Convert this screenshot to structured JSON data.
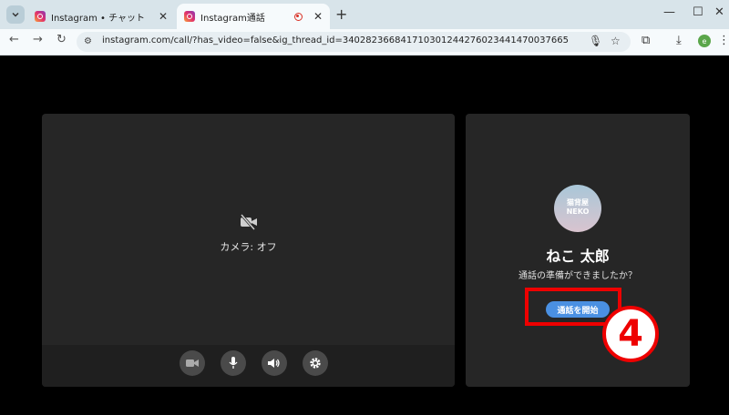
{
  "browser": {
    "tabs": [
      {
        "title": "Instagram • チャット"
      },
      {
        "title": "Instagram通話"
      }
    ],
    "url": "instagram.com/call/?has_video=false&ig_thread_id=340282366841710301244276023441470037665",
    "profile_initial": "e"
  },
  "call": {
    "camera_status": "カメラ: オフ",
    "avatar_text": [
      "猫背屋",
      "NEKO"
    ],
    "callee_name": "ねこ 太郎",
    "prompt": "通話の準備ができましたか？",
    "start_label": "通話を開始",
    "accent_color": "#4a90e2"
  },
  "annotation": {
    "step_number": "4",
    "color": "#e00000"
  },
  "icons": [
    "instagram-favicon",
    "recording-icon",
    "camera-off-icon",
    "video-icon",
    "mic-icon",
    "speaker-icon",
    "settings-icon"
  ]
}
